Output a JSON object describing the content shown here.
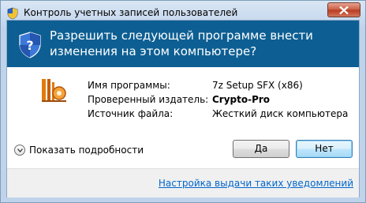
{
  "window": {
    "title": "Контроль учетных записей пользователей"
  },
  "banner": {
    "heading": "Разрешить следующей программе внести изменения на этом компьютере?"
  },
  "details": {
    "program_label": "Имя программы:",
    "program_value": "7z Setup SFX (x86)",
    "publisher_label": "Проверенный издатель:",
    "publisher_value": "Crypto-Pro",
    "source_label": "Источник файла:",
    "source_value": "Жесткий диск компьютера"
  },
  "actions": {
    "show_details": "Показать подробности",
    "yes": "Да",
    "no": "Нет"
  },
  "footer": {
    "link": "Настройка выдачи таких уведомлений"
  },
  "colors": {
    "banner": "#0d5f93",
    "link": "#0066cc"
  }
}
